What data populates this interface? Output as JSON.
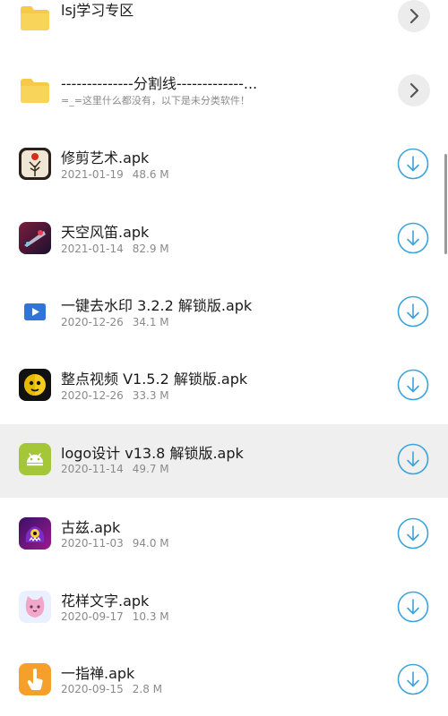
{
  "folders": [
    {
      "name": "lsj学习专区",
      "icon": "folder-icon",
      "action_icon": "chevron-right-icon"
    },
    {
      "name": "--------------分割线-------------...",
      "subtitle": "=_=这里什么都没有，以下是未分类软件！",
      "icon": "folder-icon",
      "action_icon": "chevron-right-icon"
    }
  ],
  "files": [
    {
      "name": "修剪艺术.apk",
      "date": "2021-01-19",
      "size": "48.6 M",
      "icon": "trim-art-app-icon"
    },
    {
      "name": "天空风笛.apk",
      "date": "2021-01-14",
      "size": "82.9 M",
      "icon": "sky-bagpipe-app-icon"
    },
    {
      "name": "一键去水印 3.2.2 解锁版.apk",
      "date": "2020-12-26",
      "size": "34.1 M",
      "icon": "video-play-app-icon"
    },
    {
      "name": "整点视频 V1.5.2 解锁版.apk",
      "date": "2020-12-26",
      "size": "33.3 M",
      "icon": "clock-face-app-icon"
    },
    {
      "name": "logo设计 v13.8 解锁版.apk",
      "date": "2020-11-14",
      "size": "49.7 M",
      "icon": "android-app-icon",
      "selected": true
    },
    {
      "name": "古兹.apk",
      "date": "2020-11-03",
      "size": "94.0 M",
      "icon": "monster-app-icon"
    },
    {
      "name": "花样文字.apk",
      "date": "2020-09-17",
      "size": "10.3 M",
      "icon": "cat-face-app-icon"
    },
    {
      "name": "一指禅.apk",
      "date": "2020-09-15",
      "size": "2.8 M",
      "icon": "finger-tap-app-icon"
    }
  ],
  "colors": {
    "folder": "#f7c948",
    "download_ring": "#3aa3dc",
    "selected_row": "#efefef",
    "android_green": "#a4c639"
  }
}
